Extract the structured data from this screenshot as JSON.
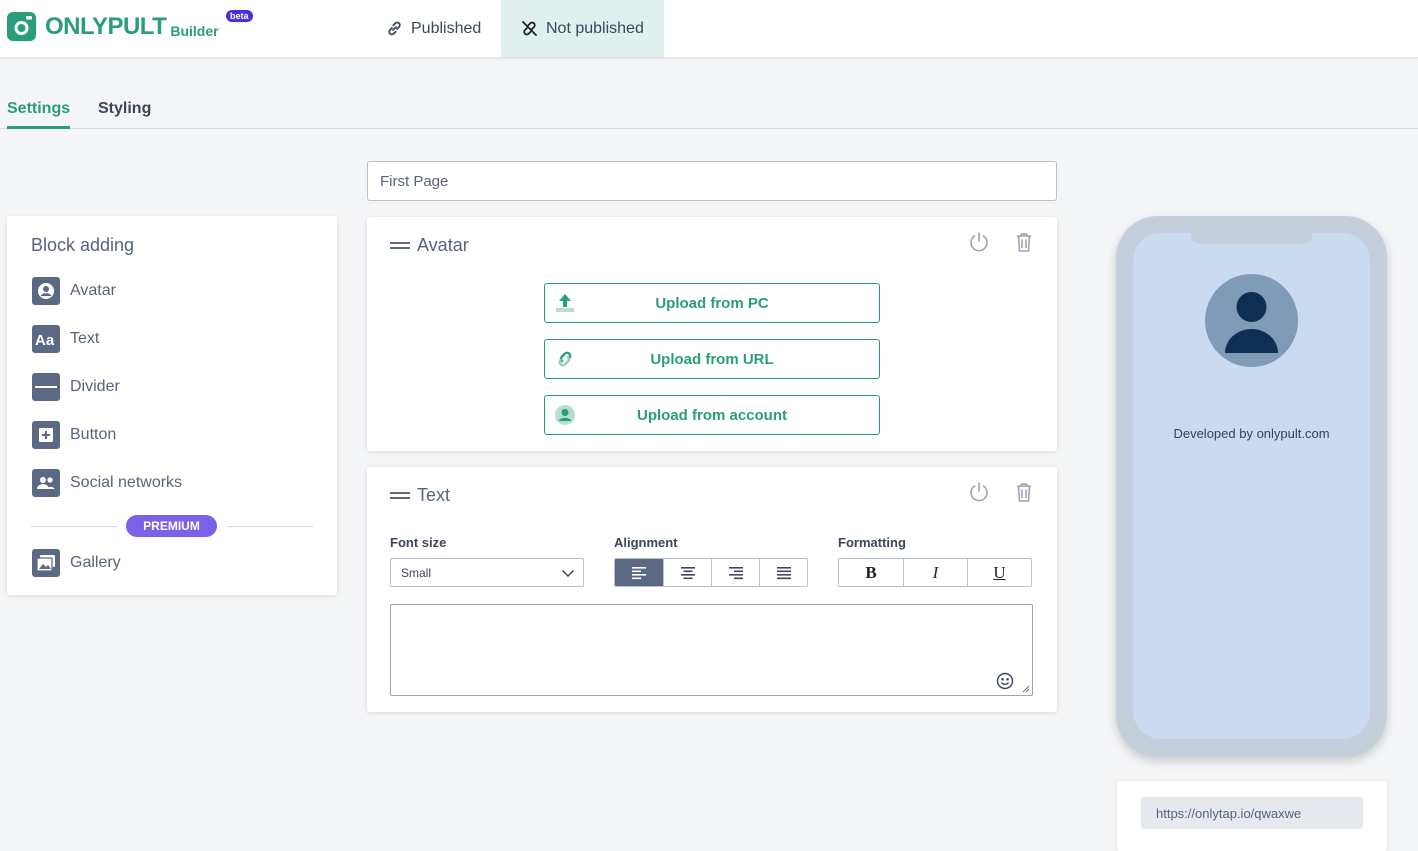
{
  "header": {
    "brand": "ONLYPULT",
    "brand_sub": "Builder",
    "badge": "beta",
    "tabs": [
      {
        "label": "Published",
        "icon": "link-icon"
      },
      {
        "label": "Not published",
        "icon": "unlink-icon",
        "active": true
      }
    ]
  },
  "settings_tabs": [
    {
      "label": "Settings",
      "active": true
    },
    {
      "label": "Styling"
    }
  ],
  "block_adding": {
    "title": "Block adding",
    "items": [
      {
        "label": "Avatar",
        "icon": "avatar-icon"
      },
      {
        "label": "Text",
        "icon": "text-icon"
      },
      {
        "label": "Divider",
        "icon": "divider-icon"
      },
      {
        "label": "Button",
        "icon": "button-icon"
      },
      {
        "label": "Social networks",
        "icon": "people-icon"
      }
    ],
    "premium_label": "PREMIUM",
    "premium_items": [
      {
        "label": "Gallery",
        "icon": "gallery-icon"
      }
    ]
  },
  "page_name": {
    "value": "First Page"
  },
  "avatar_block": {
    "title": "Avatar",
    "buttons": [
      {
        "label": "Upload from PC",
        "icon": "upload-icon"
      },
      {
        "label": "Upload from URL",
        "icon": "link-icon"
      },
      {
        "label": "Upload from account",
        "icon": "account-icon"
      }
    ]
  },
  "text_block": {
    "title": "Text",
    "font_size_label": "Font size",
    "font_size_value": "Small",
    "alignment_label": "Alignment",
    "alignment_options": [
      "left",
      "center",
      "right",
      "justify"
    ],
    "alignment_selected": "left",
    "formatting_label": "Formatting",
    "formatting_options": [
      "B",
      "I",
      "U"
    ],
    "text_value": ""
  },
  "preview": {
    "developed_by": "Developed by onlypult.com",
    "url": "https://onlytap.io/qwaxwe"
  },
  "colors": {
    "accent": "#2a9d7c",
    "premium": "#7b61e8",
    "beta": "#4b2de0",
    "icon_bg": "#5b6a82",
    "phone_screen": "#c9daf1"
  }
}
